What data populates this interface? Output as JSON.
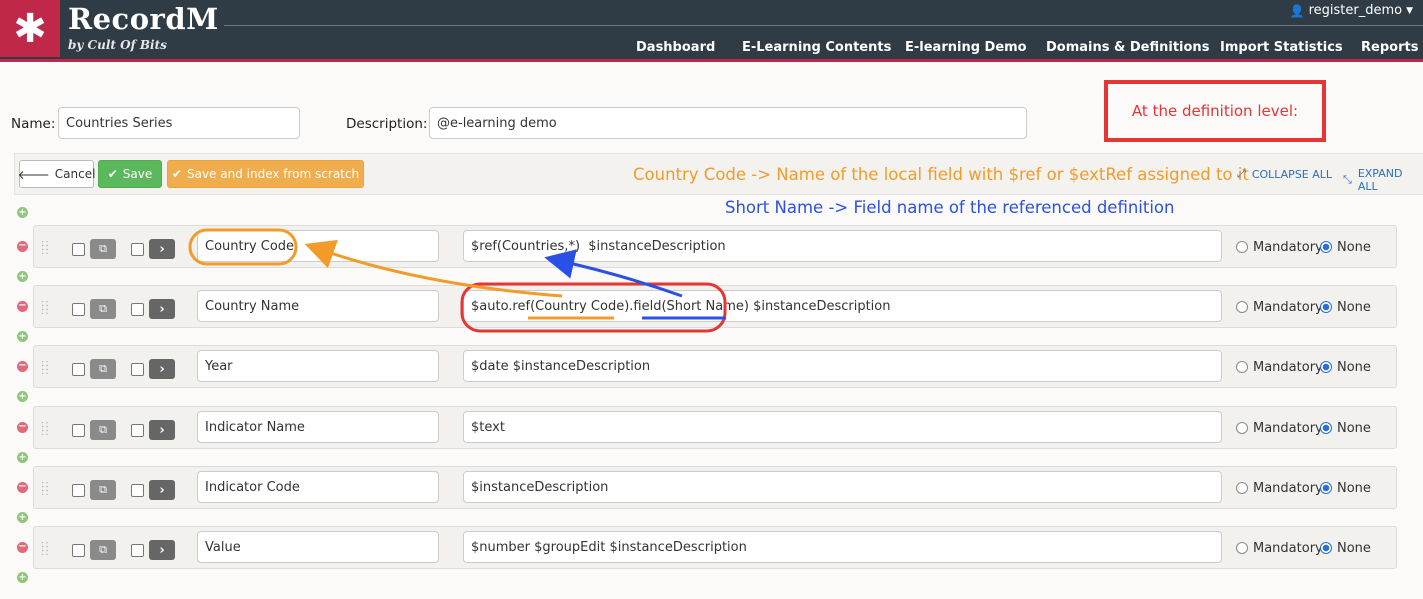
{
  "header": {
    "logo_glyph": "✱",
    "brand": "RecordM",
    "brand_sub": "by Cult Of Bits",
    "user": "register_demo",
    "nav": [
      {
        "label": "Dashboard"
      },
      {
        "label": "E-Learning Contents"
      },
      {
        "label": "E-learning Demo"
      },
      {
        "label": "Domains & Definitions"
      },
      {
        "label": "Import Statistics"
      },
      {
        "label": "Reports"
      }
    ]
  },
  "form": {
    "name_label": "Name:",
    "name_value": "Countries Series",
    "description_label": "Description:",
    "description_value": "@e-learning demo"
  },
  "toolbar": {
    "cancel_label": "Cancel",
    "save_label": "Save",
    "save_index_label": "Save and index from scratch",
    "collapse_all_label": "COLLAPSE ALL",
    "expand_all_label": "EXPAND ALL"
  },
  "annotations": {
    "box_text": "At the definition level:",
    "orange_note": "Country Code -> Name of the local field with $ref or $extRef assigned to it",
    "blue_note": "Short Name -> Field name of the referenced definition",
    "orange_color": "#f39b2a",
    "blue_color": "#2b50e6",
    "red_color": "#e53535"
  },
  "fields": [
    {
      "name": "Country Code",
      "description": "$ref(Countries,*)  $instanceDescription",
      "mandatory": false,
      "none": true
    },
    {
      "name": "Country Name",
      "description": "$auto.ref(Country Code).field(Short Name) $instanceDescription",
      "mandatory": false,
      "none": true
    },
    {
      "name": "Year",
      "description": "$date $instanceDescription",
      "mandatory": false,
      "none": true
    },
    {
      "name": "Indicator Name",
      "description": "$text",
      "mandatory": false,
      "none": true
    },
    {
      "name": "Indicator Code",
      "description": "$instanceDescription",
      "mandatory": false,
      "none": true
    },
    {
      "name": "Value",
      "description": "$number $groupEdit $instanceDescription",
      "mandatory": false,
      "none": true
    }
  ],
  "radio_labels": {
    "mandatory": "Mandatory",
    "none": "None"
  }
}
